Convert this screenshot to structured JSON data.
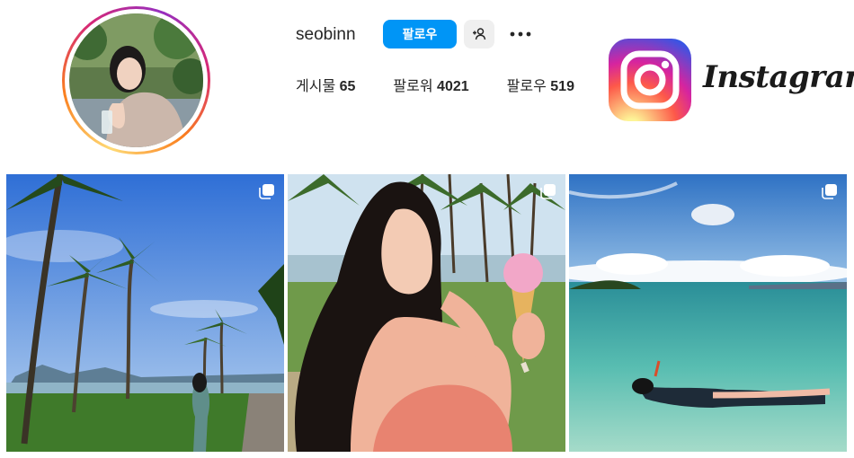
{
  "profile": {
    "username": "seobinn",
    "follow_label": "팔로우",
    "suggest_icon": "person-add-icon",
    "more_icon": "ellipsis-icon"
  },
  "stats": [
    {
      "label": "게시물",
      "value": "65"
    },
    {
      "label": "팔로워",
      "value": "4021"
    },
    {
      "label": "팔로우",
      "value": "519"
    }
  ],
  "brand": {
    "wordmark": "Instagram",
    "colors": {
      "follow_button": "#0095f6",
      "secondary_button": "#efefef"
    }
  },
  "posts": [
    {
      "scene": "palm trees by beach, woman standing on grass",
      "multi_icon": "carousel-icon"
    },
    {
      "scene": "woman holding pink ice cream cone",
      "multi_icon": "carousel-icon"
    },
    {
      "scene": "woman snorkeling in turquoise sea",
      "multi_icon": "carousel-icon"
    }
  ]
}
